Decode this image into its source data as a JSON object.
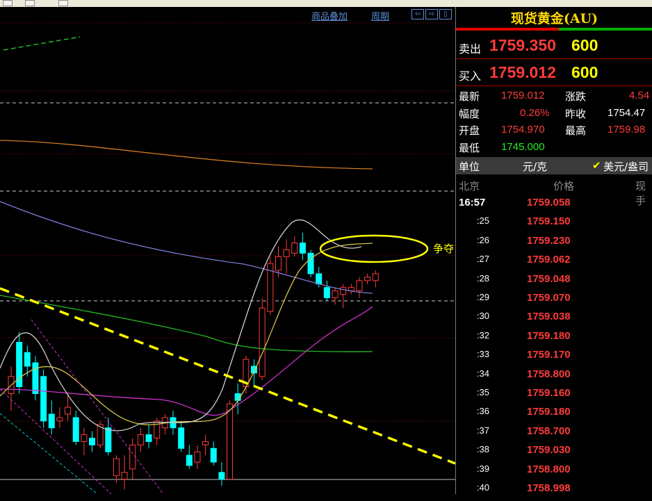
{
  "toolbar": {
    "overlay_label": "商品叠加",
    "period_label": "周期",
    "icons": [
      "nav-left-icon",
      "nav-right-icon",
      "expand-icon"
    ]
  },
  "annotation": {
    "text": "争夺"
  },
  "panel": {
    "title": "现货黄金(AU)",
    "sell": {
      "label": "卖出",
      "price": "1759.350",
      "volume": "600"
    },
    "buy": {
      "label": "买入",
      "price": "1759.012",
      "volume": "600"
    },
    "stats": {
      "latest_label": "最新",
      "latest": "1759.012",
      "change_label": "涨跌",
      "change": "4.54",
      "amplitude_label": "幅度",
      "amplitude": "0.26%",
      "prev_close_label": "昨收",
      "prev_close": "1754.47",
      "open_label": "开盘",
      "open": "1754.970",
      "high_label": "最高",
      "high": "1759.98",
      "low_label": "最低",
      "low": "1745.000"
    },
    "unit": {
      "label": "单位",
      "value": "元/克",
      "check_icon": "checkmark-icon",
      "alt": "美元/盎司"
    },
    "ticks_header": {
      "time": "北京",
      "price": "价格",
      "vol": "现手"
    },
    "ticks": [
      {
        "time": "16:57",
        "price": "1759.058"
      },
      {
        "time": ":25",
        "price": "1759.150"
      },
      {
        "time": ":26",
        "price": "1759.230"
      },
      {
        "time": ":27",
        "price": "1759.062"
      },
      {
        "time": ":28",
        "price": "1759.048"
      },
      {
        "time": ":29",
        "price": "1759.070"
      },
      {
        "time": ":30",
        "price": "1759.038"
      },
      {
        "time": ":32",
        "price": "1759.180"
      },
      {
        "time": ":33",
        "price": "1759.170"
      },
      {
        "time": ":34",
        "price": "1758.800"
      },
      {
        "time": ":35",
        "price": "1759.160"
      },
      {
        "time": ":36",
        "price": "1759.180"
      },
      {
        "time": ":37",
        "price": "1758.700"
      },
      {
        "time": ":38",
        "price": "1759.030"
      },
      {
        "time": ":39",
        "price": "1758.800"
      },
      {
        "time": ":40",
        "price": "1758.998"
      }
    ]
  },
  "colors": {
    "up": "#ff3b3b",
    "down": "#00ffff",
    "ma_short": "#cfcfcf",
    "ma_mid": "#d4c44a",
    "ma_long": "#cc33cc",
    "ma_green": "#22bb22",
    "ma_blue": "#7b7bd6",
    "ma_orange": "#d07a20",
    "trend": "#ffff00"
  },
  "chart_data": {
    "type": "candlestick",
    "candles": [
      {
        "o": 0.2,
        "h": 0.28,
        "l": 0.15,
        "c": 0.25
      },
      {
        "o": 0.35,
        "h": 0.38,
        "l": 0.2,
        "c": 0.22
      },
      {
        "o": 0.32,
        "h": 0.34,
        "l": 0.25,
        "c": 0.28
      },
      {
        "o": 0.29,
        "h": 0.31,
        "l": 0.18,
        "c": 0.2
      },
      {
        "o": 0.25,
        "h": 0.27,
        "l": 0.1,
        "c": 0.12
      },
      {
        "o": 0.14,
        "h": 0.18,
        "l": 0.08,
        "c": 0.1
      },
      {
        "o": 0.12,
        "h": 0.16,
        "l": 0.1,
        "c": 0.13
      },
      {
        "o": 0.14,
        "h": 0.2,
        "l": 0.12,
        "c": 0.16
      },
      {
        "o": 0.13,
        "h": 0.15,
        "l": 0.05,
        "c": 0.06
      },
      {
        "o": 0.06,
        "h": 0.1,
        "l": 0.02,
        "c": 0.08
      },
      {
        "o": 0.07,
        "h": 0.09,
        "l": 0.03,
        "c": 0.05
      },
      {
        "o": 0.05,
        "h": 0.12,
        "l": 0.04,
        "c": 0.11
      },
      {
        "o": 0.1,
        "h": 0.13,
        "l": 0.02,
        "c": 0.03
      },
      {
        "o": -0.04,
        "h": 0.02,
        "l": -0.06,
        "c": 0.01
      },
      {
        "o": -0.05,
        "h": 0.02,
        "l": -0.08,
        "c": -0.03
      },
      {
        "o": -0.02,
        "h": 0.07,
        "l": -0.05,
        "c": 0.05
      },
      {
        "o": 0.05,
        "h": 0.1,
        "l": 0.03,
        "c": 0.08
      },
      {
        "o": 0.08,
        "h": 0.11,
        "l": 0.04,
        "c": 0.06
      },
      {
        "o": 0.07,
        "h": 0.13,
        "l": 0.05,
        "c": 0.12
      },
      {
        "o": 0.1,
        "h": 0.14,
        "l": 0.08,
        "c": 0.13
      },
      {
        "o": 0.13,
        "h": 0.15,
        "l": 0.08,
        "c": 0.1
      },
      {
        "o": 0.1,
        "h": 0.12,
        "l": 0.03,
        "c": 0.04
      },
      {
        "o": 0.02,
        "h": 0.05,
        "l": -0.02,
        "c": -0.01
      },
      {
        "o": 0.0,
        "h": 0.05,
        "l": -0.02,
        "c": 0.03
      },
      {
        "o": 0.05,
        "h": 0.08,
        "l": 0.02,
        "c": 0.06
      },
      {
        "o": 0.04,
        "h": 0.06,
        "l": -0.01,
        "c": 0.0
      },
      {
        "o": -0.03,
        "h": 0.0,
        "l": -0.07,
        "c": -0.05
      },
      {
        "o": -0.05,
        "h": 0.18,
        "l": -0.05,
        "c": 0.17
      },
      {
        "o": 0.2,
        "h": 0.23,
        "l": 0.14,
        "c": 0.18
      },
      {
        "o": 0.22,
        "h": 0.31,
        "l": 0.2,
        "c": 0.3
      },
      {
        "o": 0.28,
        "h": 0.3,
        "l": 0.22,
        "c": 0.26
      },
      {
        "o": 0.25,
        "h": 0.48,
        "l": 0.24,
        "c": 0.45
      },
      {
        "o": 0.44,
        "h": 0.6,
        "l": 0.43,
        "c": 0.58
      },
      {
        "o": 0.56,
        "h": 0.63,
        "l": 0.54,
        "c": 0.6
      },
      {
        "o": 0.6,
        "h": 0.65,
        "l": 0.55,
        "c": 0.62
      },
      {
        "o": 0.61,
        "h": 0.66,
        "l": 0.6,
        "c": 0.64
      },
      {
        "o": 0.64,
        "h": 0.67,
        "l": 0.59,
        "c": 0.61
      },
      {
        "o": 0.61,
        "h": 0.62,
        "l": 0.54,
        "c": 0.55
      },
      {
        "o": 0.55,
        "h": 0.57,
        "l": 0.51,
        "c": 0.52
      },
      {
        "o": 0.51,
        "h": 0.53,
        "l": 0.47,
        "c": 0.48
      },
      {
        "o": 0.48,
        "h": 0.51,
        "l": 0.46,
        "c": 0.5
      },
      {
        "o": 0.49,
        "h": 0.52,
        "l": 0.45,
        "c": 0.51
      },
      {
        "o": 0.5,
        "h": 0.52,
        "l": 0.49,
        "c": 0.51
      },
      {
        "o": 0.5,
        "h": 0.54,
        "l": 0.48,
        "c": 0.53
      },
      {
        "o": 0.53,
        "h": 0.55,
        "l": 0.52,
        "c": 0.54
      },
      {
        "o": 0.53,
        "h": 0.56,
        "l": 0.51,
        "c": 0.55
      }
    ]
  }
}
